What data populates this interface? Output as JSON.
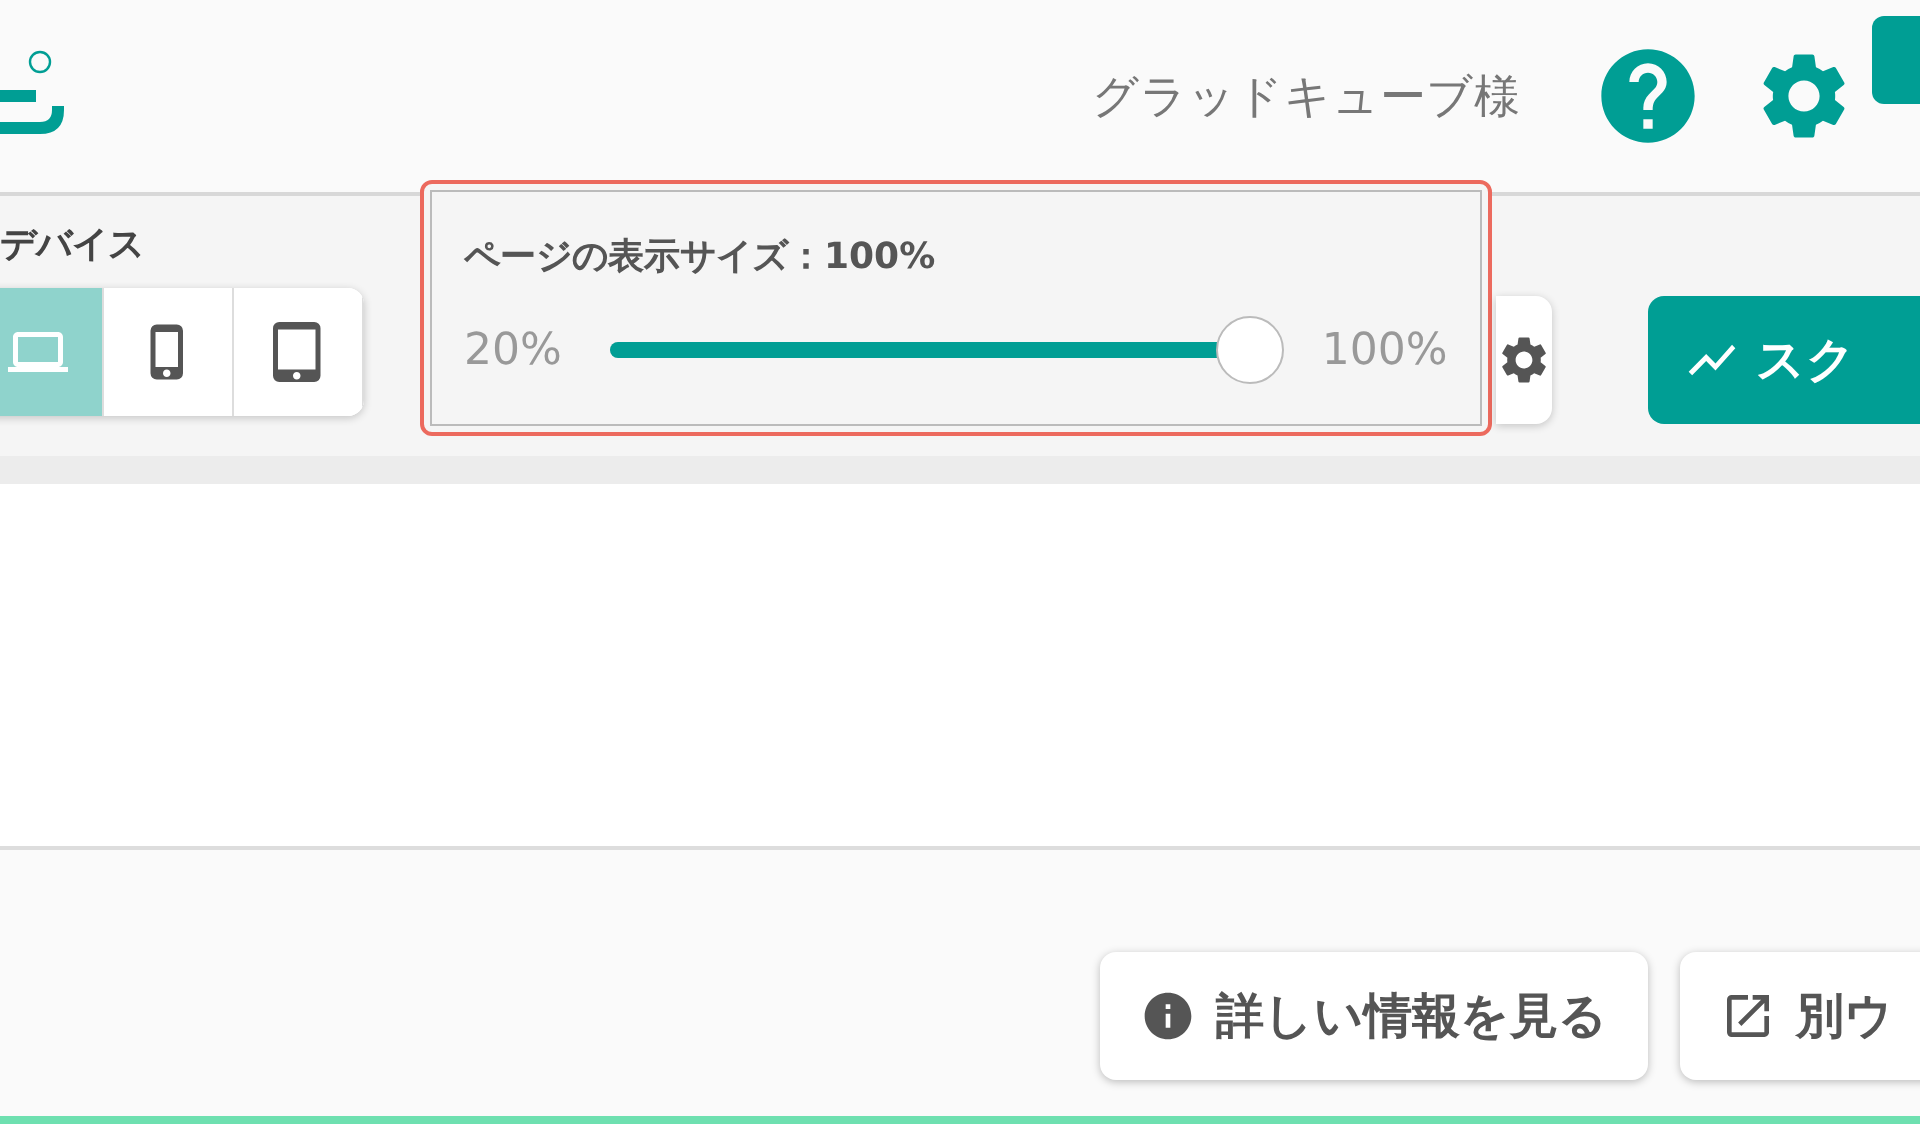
{
  "header": {
    "user_name": "グラッドキューブ様"
  },
  "device": {
    "label": "デバイス",
    "options": [
      {
        "kind": "laptop",
        "selected": true
      },
      {
        "kind": "phone",
        "selected": false
      },
      {
        "kind": "tablet",
        "selected": false
      }
    ]
  },
  "zoom": {
    "title": "ページの表示サイズ：100%",
    "min": "20%",
    "max": "100%",
    "level": 1
  },
  "report_button": {
    "label": "スク"
  },
  "actions": [
    {
      "kind": "info",
      "label": "詳しい情報を見る"
    },
    {
      "kind": "external",
      "label": "別ウ"
    }
  ]
}
